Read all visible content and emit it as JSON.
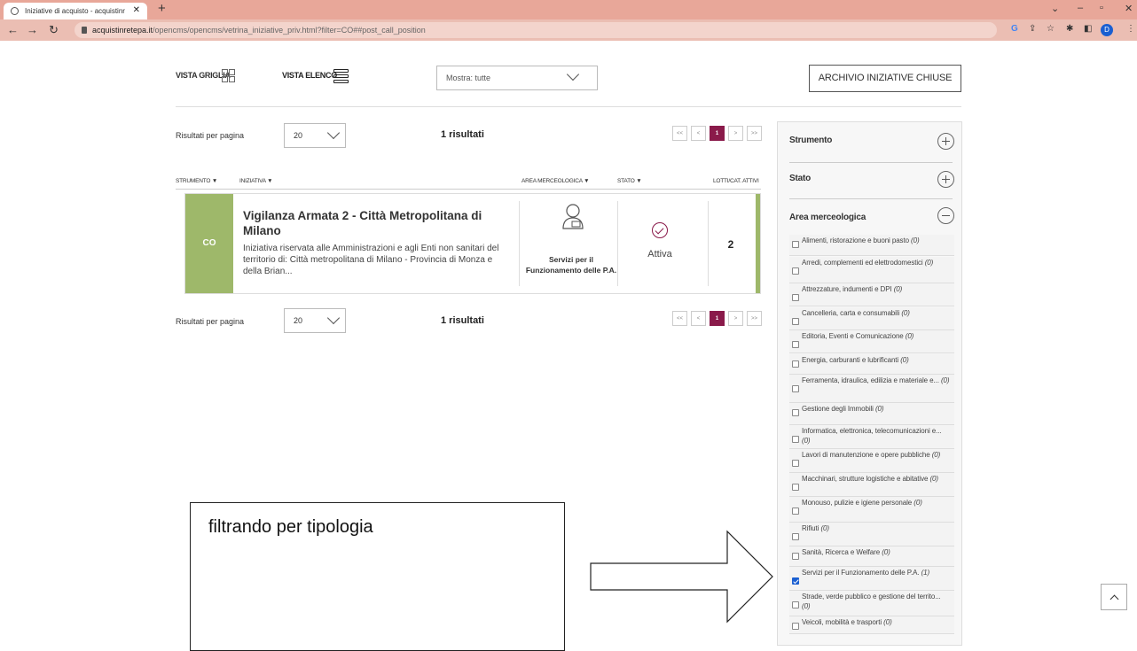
{
  "browser": {
    "tab_title": "Iniziative di acquisto - acquistinr",
    "url_host": "acquistinretepa.it",
    "url_path": "/opencms/opencms/vetrina_iniziative_priv.html?filter=CO##post_call_position",
    "profile_initial": "D"
  },
  "toolbar": {
    "vista_griglia": "VISTA GRIGLIA",
    "vista_elenco": "VISTA ELENCO",
    "mostra": "Mostra: tutte",
    "archivio": "ARCHIVIO INIZIATIVE CHIUSE"
  },
  "results": {
    "per_page_label": "Risultati per pagina",
    "per_page_value": "20",
    "count": "1 risultati",
    "pager": [
      "<<",
      "<",
      "1",
      ">",
      ">>"
    ],
    "current_page": "1"
  },
  "table": {
    "headers": {
      "strumento": "STRUMENTO ▼",
      "iniziativa": "INIZIATIVA ▼",
      "area": "AREA MERCEOLOGICA ▼",
      "stato": "STATO ▼",
      "lotti": "LOTTI/CAT. ATTIVI"
    },
    "row": {
      "code": "CO",
      "title": "Vigilanza Armata 2 - Città Metropolitana di Milano",
      "description": "Iniziativa riservata alle Amministrazioni e agli Enti non sanitari del territorio di: Città metropolitana di Milano - Provincia di Monza e della Brian...",
      "area": "Servizi per il Funzionamento delle P.A.",
      "stato": "Attiva",
      "lotti": "2"
    }
  },
  "sidebar": {
    "sections": {
      "strumento": "Strumento",
      "stato": "Stato",
      "area": "Area merceologica"
    },
    "options": [
      {
        "label": "Alimenti, ristorazione e buoni pasto",
        "count": "(0)",
        "checked": false
      },
      {
        "label": "Arredi, complementi ed elettrodomestici",
        "count": "(0)",
        "checked": false
      },
      {
        "label": "Attrezzature, indumenti e DPI",
        "count": "(0)",
        "checked": false
      },
      {
        "label": "Cancelleria, carta e consumabili",
        "count": "(0)",
        "checked": false
      },
      {
        "label": "Editoria, Eventi e Comunicazione",
        "count": "(0)",
        "checked": false
      },
      {
        "label": "Energia, carburanti e lubrificanti",
        "count": "(0)",
        "checked": false
      },
      {
        "label": "Ferramenta, idraulica, edilizia e materiale e...",
        "count": "(0)",
        "checked": false
      },
      {
        "label": "Gestione degli Immobili",
        "count": "(0)",
        "checked": false
      },
      {
        "label": "Informatica, elettronica, telecomunicazioni e...",
        "count": "(0)",
        "checked": false
      },
      {
        "label": "Lavori di manutenzione e opere pubbliche",
        "count": "(0)",
        "checked": false
      },
      {
        "label": "Macchinari, strutture logistiche e abitative",
        "count": "(0)",
        "checked": false
      },
      {
        "label": "Monouso, pulizie e igiene personale",
        "count": "(0)",
        "checked": false
      },
      {
        "label": "Rifiuti",
        "count": "(0)",
        "checked": false
      },
      {
        "label": "Sanità, Ricerca e Welfare",
        "count": "(0)",
        "checked": false
      },
      {
        "label": "Servizi per il Funzionamento delle P.A.",
        "count": "(1)",
        "checked": true
      },
      {
        "label": "Strade, verde pubblico e gestione del territo...",
        "count": "(0)",
        "checked": false
      },
      {
        "label": "Veicoli, mobilità e trasporti",
        "count": "(0)",
        "checked": false
      }
    ]
  },
  "annotation": {
    "text": "filtrando per tipologia"
  }
}
